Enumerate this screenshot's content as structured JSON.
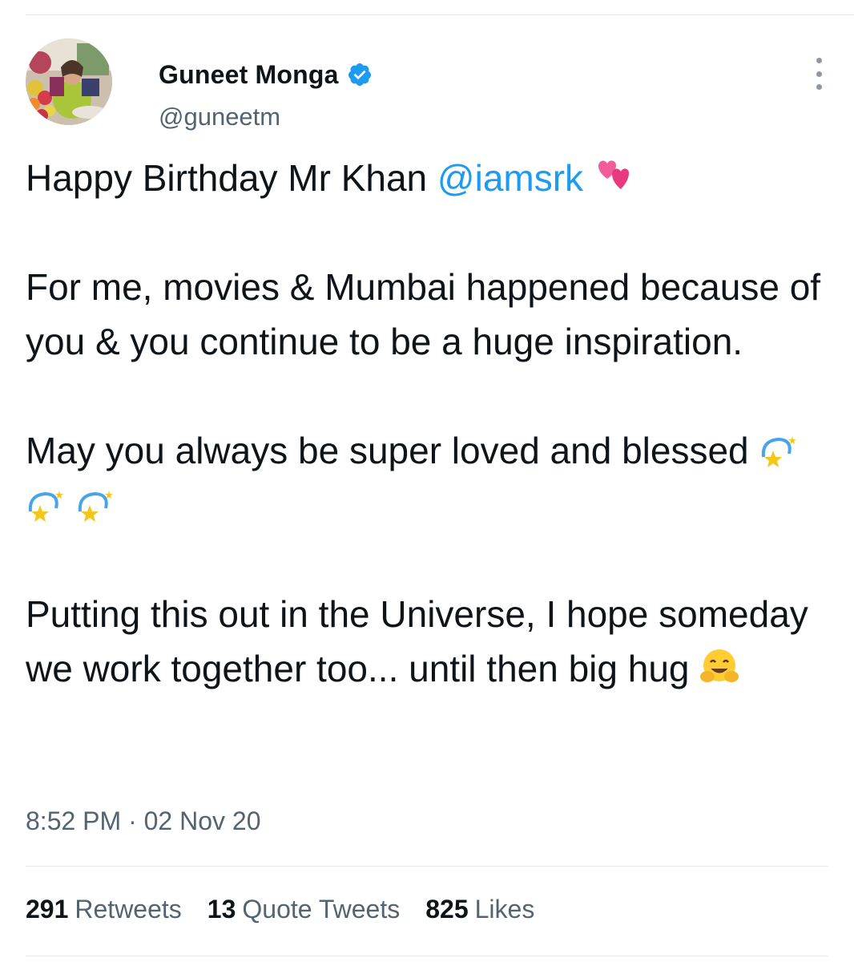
{
  "author": {
    "display_name": "Guneet Monga",
    "handle": "@guneetm",
    "verified": true
  },
  "tweet": {
    "line1_text": "Happy Birthday Mr Khan ",
    "line1_mention": "@iamsrk",
    "line1_emoji": "two-hearts",
    "para2": "For me, movies & Mumbai happened because of you & you continue to be a huge inspiration.",
    "para3_text": "May you always be super loved and blessed",
    "para3_emoji": "dizzy-star",
    "para3_emoji_count": 3,
    "para4_text": "Putting this out in the Universe, I hope someday we work together too... until then big hug",
    "para4_emoji": "hugging-face"
  },
  "timestamp": "8:52 PM · 02 Nov 20",
  "stats": {
    "retweets_count": "291",
    "retweets_label": "Retweets",
    "quote_count": "13",
    "quote_label": "Quote Tweets",
    "likes_count": "825",
    "likes_label": "Likes"
  },
  "colors": {
    "link": "#1d9bf0",
    "secondary_text": "#536471",
    "primary_text": "#0f1419",
    "divider": "#e6e9eb"
  },
  "icons": {
    "verified": "verified-badge-icon",
    "more": "more-options-icon"
  }
}
